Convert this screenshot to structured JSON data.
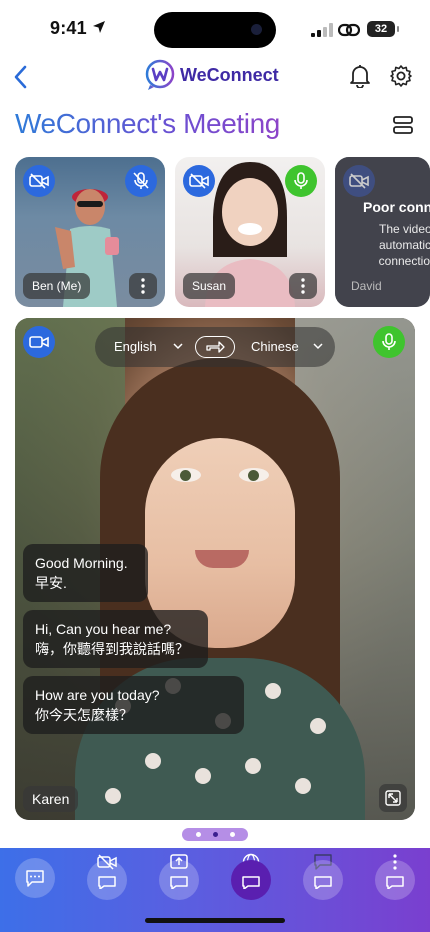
{
  "status": {
    "time": "9:41",
    "battery": "32"
  },
  "app": {
    "name": "WeConnect",
    "brand_color": "#3f2aa5",
    "accent_green": "#3fc42e",
    "accent_blue": "#2c69de"
  },
  "page": {
    "title": "WeConnect's Meeting"
  },
  "participants": [
    {
      "name": "Ben (Me)",
      "video": "off",
      "mic": "muted"
    },
    {
      "name": "Susan",
      "video": "off",
      "mic": "active"
    },
    {
      "name": "David",
      "status_title": "Poor conne",
      "status_message": "The video wil automatically connection in"
    }
  ],
  "main_video": {
    "speaker": "Karen",
    "source_language": "English",
    "target_language": "Chinese",
    "captions": [
      {
        "en": "Good Morning.",
        "zh": "早安."
      },
      {
        "en": "Hi, Can you hear me?",
        "zh": "嗨，你聽得到我說話嗎？"
      },
      {
        "en": "How are you today?",
        "zh": "你今天怎麼樣？"
      }
    ]
  },
  "pager": {
    "pages": 3,
    "active": 2
  },
  "toolbar": {
    "icons": [
      "chat-icon",
      "video-off-icon",
      "share-screen-icon",
      "translate-globe-icon",
      "message-icon",
      "more-icon"
    ]
  }
}
